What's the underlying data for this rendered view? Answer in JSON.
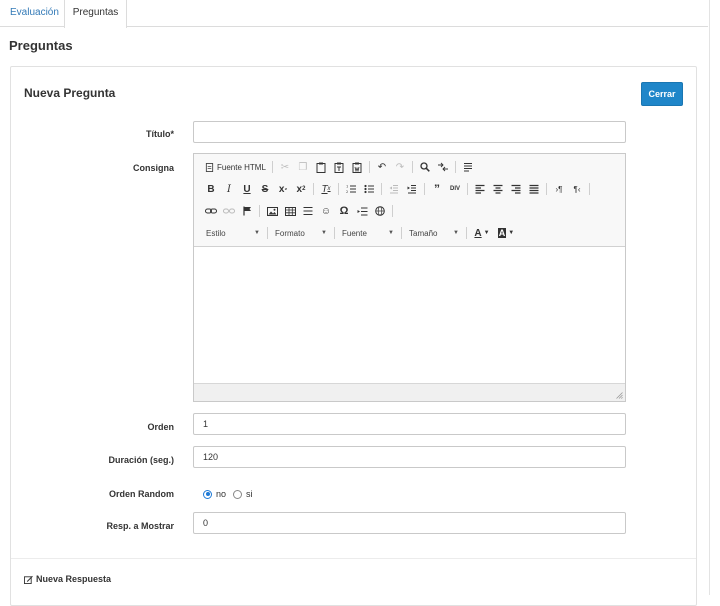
{
  "tabs": [
    {
      "label": "Evaluación"
    },
    {
      "label": "Preguntas"
    }
  ],
  "page_title": "Preguntas",
  "card": {
    "title": "Nueva Pregunta",
    "close_label": "Cerrar"
  },
  "form": {
    "titulo_label": "Título*",
    "titulo_value": "",
    "consigna_label": "Consigna",
    "orden_label": "Orden",
    "orden_value": "1",
    "duracion_label": "Duración (seg.)",
    "duracion_value": "120",
    "orden_random_label": "Orden Random",
    "orden_random_options": [
      {
        "label": "no",
        "selected": true
      },
      {
        "label": "si",
        "selected": false
      }
    ],
    "resp_label": "Resp. a Mostrar",
    "resp_value": "0"
  },
  "editor": {
    "source_label": "Fuente HTML",
    "combos": [
      {
        "label": "Estilo"
      },
      {
        "label": "Formato"
      },
      {
        "label": "Fuente"
      },
      {
        "label": "Tamaño"
      }
    ]
  },
  "footer": {
    "new_answer_label": "Nueva Respuesta"
  },
  "colors": {
    "accent": "#1f86c9",
    "link": "#337ab7"
  }
}
